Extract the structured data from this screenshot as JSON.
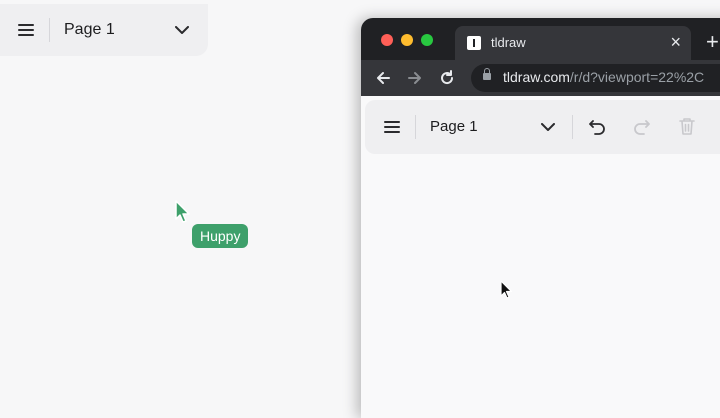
{
  "left_app": {
    "menu_icon": "hamburger-icon",
    "page_name": "Page 1",
    "dropdown_icon": "chevron-down-icon"
  },
  "collaborator": {
    "name": "Huppy",
    "color": "#3ea06b"
  },
  "browser": {
    "traffic_lights": [
      "#ff5f57",
      "#febc2e",
      "#28c840"
    ],
    "tab_title": "tldraw",
    "tab_close": "×",
    "new_tab": "+",
    "url_host": "tldraw.com",
    "url_path": "/r/d?viewport=22%2C"
  },
  "right_app": {
    "menu_icon": "hamburger-icon",
    "page_name": "Page 1",
    "undo_icon": "undo-icon",
    "redo_icon": "redo-icon",
    "delete_icon": "trash-icon"
  }
}
